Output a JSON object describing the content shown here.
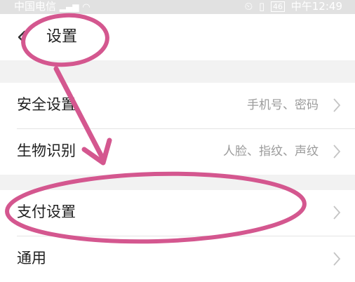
{
  "status_bar": {
    "carrier": "中国电信",
    "time": "中午12:49",
    "battery": "46"
  },
  "nav": {
    "title": "设置",
    "back_icon": "back-chevron-icon"
  },
  "groups": [
    {
      "items": [
        {
          "label": "安全设置",
          "value": "手机号、密码",
          "icon": "chevron-right-icon"
        },
        {
          "label": "生物识别",
          "value": "人脸、指纹、声纹",
          "icon": "chevron-right-icon"
        }
      ]
    },
    {
      "items": [
        {
          "label": "支付设置",
          "value": "",
          "icon": "chevron-right-icon"
        },
        {
          "label": "通用",
          "value": "",
          "icon": "chevron-right-icon"
        }
      ]
    }
  ],
  "annotation": {
    "color": "#d4578f",
    "shapes": [
      "ellipse-around-title",
      "arrow-down",
      "ellipse-around-payment-settings"
    ]
  },
  "colors": {
    "background": "#ffffff",
    "section_gap": "#f2f2f2",
    "secondary_text": "#9b9b9b",
    "status_bar": "#e1e1e1"
  }
}
